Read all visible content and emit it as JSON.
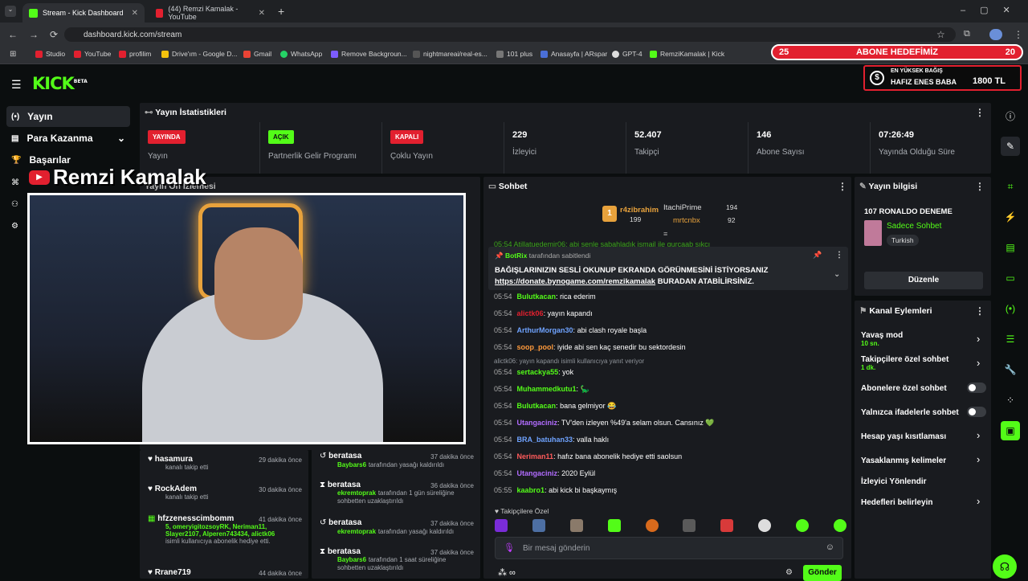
{
  "browser": {
    "tabs": [
      {
        "title": "Stream - Kick Dashboard",
        "active": true
      },
      {
        "title": "(44) Remzi Kamalak - YouTube",
        "active": false
      }
    ],
    "url": "dashboard.kick.com/stream",
    "bookmarks": [
      "Studio",
      "YouTube",
      "profilim",
      "Drive'ım - Google D...",
      "Gmail",
      "WhatsApp",
      "Remove Backgroun...",
      "nightmareai/real-es...",
      "101 plus",
      "Anasayfa | ARspar",
      "GPT-4",
      "RemziKamalak | Kick"
    ]
  },
  "overlay": {
    "goal_left": "25",
    "goal_title": "ABONE HEDEFİMİZ",
    "goal_right": "20",
    "donate_title": "EN YÜKSEK BAĞIŞ",
    "donate_name": "HAFIZ ENES BABA",
    "donate_amount": "1800 TL",
    "youtube_name": "Remzi Kamalak"
  },
  "nav": {
    "logo": "KICK",
    "logo_beta": "BETA",
    "items": [
      "Yayın",
      "Para Kazanma",
      "Başarılar"
    ]
  },
  "stats": {
    "title": "Yayın İstatistikleri",
    "cells": [
      {
        "badge": "YAYINDA",
        "label": "Yayın",
        "color": "#e2202f"
      },
      {
        "badge": "AÇIK",
        "label": "Partnerlik Gelir Programı",
        "color": "#53fc18"
      },
      {
        "badge": "KAPALI",
        "label": "Çoklu Yayın",
        "color": "#e2202f"
      },
      {
        "value": "229",
        "label": "İzleyici"
      },
      {
        "value": "52.407",
        "label": "Takipçi"
      },
      {
        "value": "146",
        "label": "Abone Sayısı"
      },
      {
        "value": "07:26:49",
        "label": "Yayında Olduğu Süre"
      }
    ]
  },
  "preview_title": "Yayın Ön İzlemesi",
  "activity": {
    "left": [
      {
        "name": "hasamura",
        "time": "29 dakika önce",
        "sub": "kanalı takip etti"
      },
      {
        "name": "RockAdem",
        "time": "30 dakika önce",
        "sub": "kanalı takip etti"
      },
      {
        "name": "hfzzenesscimbomm",
        "time": "41 dakika önce",
        "green": "5, omeryigitozsoyRK, Neriman11, Slayer2107, Alperen743434, alictk06",
        "sub": "isimli kullanıcıya abonelik hediye etti."
      },
      {
        "name": "Rrane719",
        "time": "44 dakika önce",
        "sub": ""
      }
    ],
    "right": [
      {
        "name": "beratasa",
        "time": "37 dakika önce",
        "green": "Baybars6",
        "sub": "tarafından yasağı kaldırıldı"
      },
      {
        "name": "beratasa",
        "time": "36 dakika önce",
        "green": "ekremtoprak",
        "sub": "tarafından 1 gün süreliğine sohbetten uzaklaştırıldı"
      },
      {
        "name": "beratasa",
        "time": "37 dakika önce",
        "green": "ekremtoprak",
        "sub": "tarafından yasağı kaldırıldı"
      },
      {
        "name": "beratasa",
        "time": "37 dakika önce",
        "green": "Baybars6",
        "sub": "tarafından 1 saat süreliğine sohbetten uzaklaştırıldı"
      }
    ]
  },
  "chat": {
    "title": "Sohbet",
    "top_gifters": [
      {
        "name": "r4zibrahim",
        "count": "199"
      },
      {
        "name": "ItachiPrime",
        "count": "194"
      },
      {
        "name": "mrtcnbx",
        "count": "92"
      }
    ],
    "partial": "05:54 Atillatuedemir06: abi senle sabahladık ismail ile gurcaab sıkcı",
    "pinned": {
      "by": "BotRix",
      "by_suffix": "tarafından sabitlendi",
      "text": "BAĞIŞLARINIZIN SESLİ OKUNUP EKRANDA GÖRÜNMESİNİ İSTİYORSANIZ",
      "link": "https://donate.bynogame.com/remzikamalak",
      "link_suffix": "BURADAN ATABİLİRSİNİZ."
    },
    "messages": [
      {
        "time": "05:54",
        "user": "Bulutkacan",
        "color": "#53fc18",
        "text": "rica ederim"
      },
      {
        "time": "05:54",
        "user": "alictk06",
        "color": "#e2202f",
        "text": "yayın kapandı"
      },
      {
        "time": "05:54",
        "user": "ArthurMorgan30",
        "color": "#6fa3ff",
        "text": "abi clash royale başla"
      },
      {
        "time": "05:54",
        "user": "soop_pool",
        "color": "#ff9a3c",
        "text": "iyide abi sen kaç senedir bu sektordesin"
      },
      {
        "time": "05:54",
        "user": "sertackya55",
        "color": "#53fc18",
        "text": "yok",
        "reply": "alictk06: yayın kapandı isimli kullanıcıya yanıt veriyor"
      },
      {
        "time": "05:54",
        "user": "Muhammedkutu1",
        "color": "#53fc18",
        "text": "🦕"
      },
      {
        "time": "05:54",
        "user": "Bulutkacan",
        "color": "#53fc18",
        "text": "bana gelmiyor 😂"
      },
      {
        "time": "05:54",
        "user": "Utangaciniz",
        "color": "#b26cff",
        "text": "TV'den izleyen %49'a selam olsun. Cansınız 💚"
      },
      {
        "time": "05:54",
        "user": "BRA_batuhan33",
        "color": "#6fa3ff",
        "text": "valla haklı"
      },
      {
        "time": "05:54",
        "user": "Neriman11",
        "color": "#ff5b5b",
        "text": "hafız bana abonelik hediye etti saolsun"
      },
      {
        "time": "05:54",
        "user": "Utangaciniz",
        "color": "#b26cff",
        "text": "2020 Eylül"
      },
      {
        "time": "05:55",
        "user": "kaabro1",
        "color": "#53fc18",
        "text": "abi kick bi başkaymış"
      }
    ],
    "followers_only": "Takipçilere Özel",
    "placeholder": "Bir mesaj gönderin",
    "send": "Gönder"
  },
  "stream_info": {
    "title": "Yayın bilgisi",
    "stream_title": "107 RONALDO DENEME",
    "category": "Sadece Sohbet",
    "language": "Turkish",
    "edit": "Düzenle"
  },
  "channel_actions": {
    "title": "Kanal Eylemleri",
    "items": [
      {
        "label": "Yavaş mod",
        "sub": "10 sn.",
        "type": "chevron"
      },
      {
        "label": "Takipçilere özel sohbet",
        "sub": "1 dk.",
        "type": "chevron"
      },
      {
        "label": "Abonelere özel sohbet",
        "sub": "",
        "type": "toggle"
      },
      {
        "label": "Yalnızca ifadelerle sohbet",
        "sub": "",
        "type": "toggle"
      },
      {
        "label": "Hesap yaşı kısıtlaması",
        "sub": "",
        "type": "chevron"
      },
      {
        "label": "Yasaklanmış kelimeler",
        "sub": "",
        "type": "chevron"
      },
      {
        "label": "İzleyici Yönlendir",
        "sub": "",
        "type": "none"
      },
      {
        "label": "Hedefleri belirleyin",
        "sub": "",
        "type": "chevron"
      }
    ]
  },
  "colors": {
    "accent": "#53fc18",
    "live": "#e2202f",
    "panel": "#191b1f"
  }
}
